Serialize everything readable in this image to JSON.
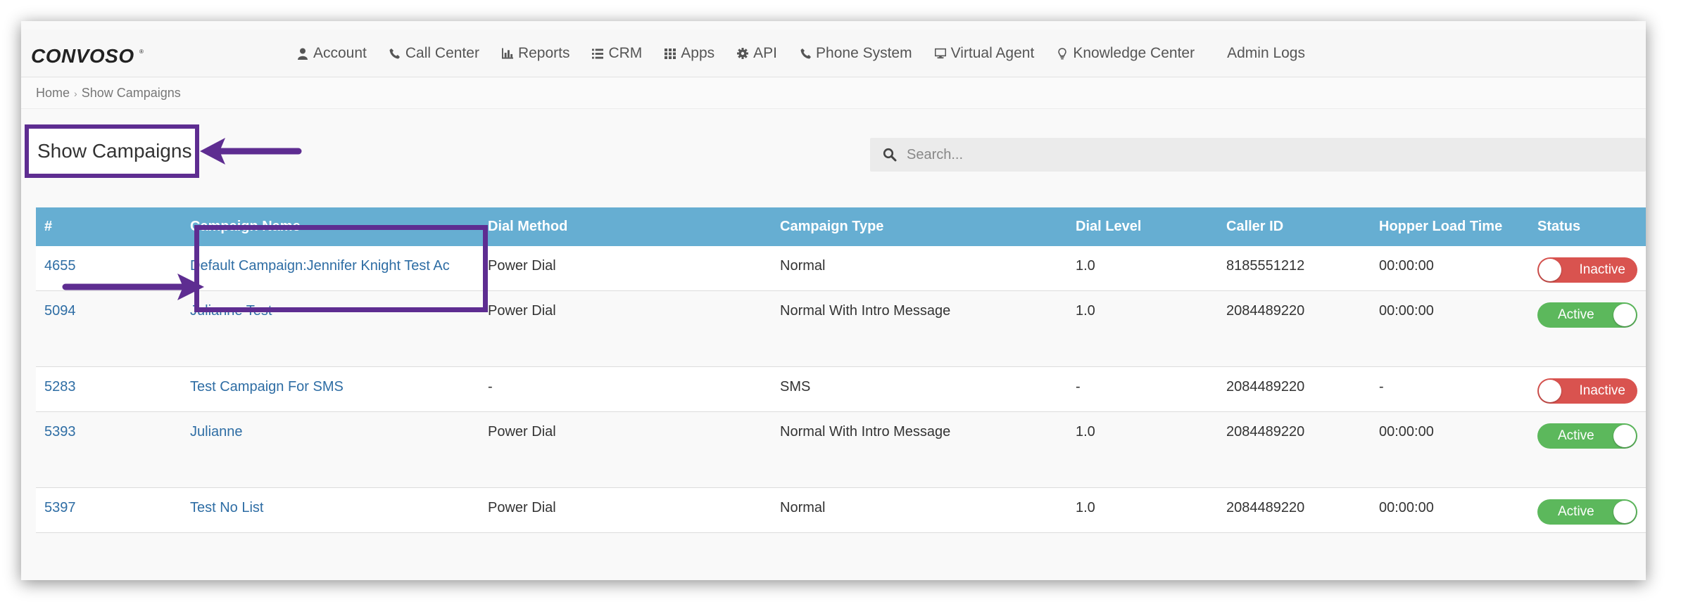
{
  "nav": {
    "brand": "CONVOSO",
    "items": [
      {
        "label": "Account",
        "icon": "user-icon"
      },
      {
        "label": "Call Center",
        "icon": "phone-icon"
      },
      {
        "label": "Reports",
        "icon": "bar-chart-icon"
      },
      {
        "label": "CRM",
        "icon": "list-icon"
      },
      {
        "label": "Apps",
        "icon": "grid-icon"
      },
      {
        "label": "API",
        "icon": "gear-icon"
      },
      {
        "label": "Phone System",
        "icon": "phone-icon"
      },
      {
        "label": "Virtual Agent",
        "icon": "monitor-icon"
      },
      {
        "label": "Knowledge Center",
        "icon": "lightbulb-icon"
      }
    ],
    "admin_logs": "Admin Logs"
  },
  "breadcrumb": {
    "home": "Home",
    "separator": "›",
    "current": "Show Campaigns"
  },
  "page": {
    "title": "Show Campaigns"
  },
  "search": {
    "placeholder": "Search..."
  },
  "table": {
    "headers": {
      "id": "#",
      "name": "Campaign Name",
      "dial_method": "Dial Method",
      "type": "Campaign Type",
      "dial_level": "Dial Level",
      "caller_id": "Caller ID",
      "hopper": "Hopper Load Time",
      "status": "Status"
    },
    "rows": [
      {
        "id": "4655",
        "name": "Default Campaign:Jennifer Knight Test Ac",
        "dial_method": "Power Dial",
        "type": "Normal",
        "dial_level": "1.0",
        "caller_id": "8185551212",
        "hopper": "00:00:00",
        "status": "Inactive"
      },
      {
        "id": "5094",
        "name": "Julianne Test",
        "dial_method": "Power Dial",
        "type": "Normal With Intro Message",
        "dial_level": "1.0",
        "caller_id": "2084489220",
        "hopper": "00:00:00",
        "status": "Active"
      },
      {
        "id": "5283",
        "name": "Test Campaign For SMS",
        "dial_method": "-",
        "type": "SMS",
        "dial_level": "-",
        "caller_id": "2084489220",
        "hopper": "-",
        "status": "Inactive"
      },
      {
        "id": "5393",
        "name": "Julianne",
        "dial_method": "Power Dial",
        "type": "Normal With Intro Message",
        "dial_level": "1.0",
        "caller_id": "2084489220",
        "hopper": "00:00:00",
        "status": "Active"
      },
      {
        "id": "5397",
        "name": "Test No List",
        "dial_method": "Power Dial",
        "type": "Normal",
        "dial_level": "1.0",
        "caller_id": "2084489220",
        "hopper": "00:00:00",
        "status": "Active"
      }
    ]
  },
  "colors": {
    "annotation": "#5e2d91",
    "table_header": "#66aed2",
    "link": "#2e6da4",
    "active": "#5cb85c",
    "inactive": "#d9534f"
  }
}
